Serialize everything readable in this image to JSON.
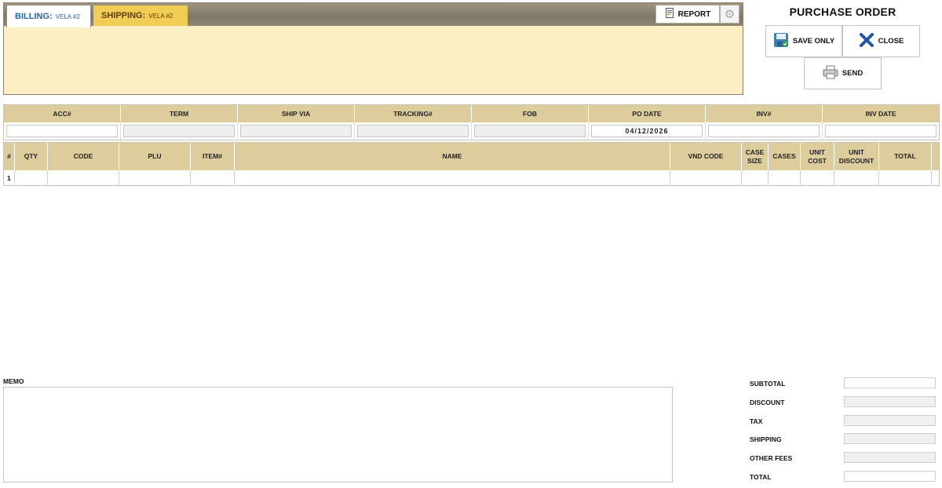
{
  "address_tabs": {
    "billing_label": "BILLING:",
    "billing_value": "VELA #2",
    "shipping_label": "SHIPPING:",
    "shipping_value": "VELA #2",
    "report_label": "REPORT"
  },
  "actions": {
    "title": "PURCHASE ORDER",
    "save_label": "SAVE ONLY",
    "close_label": "CLOSE",
    "send_label": "SEND"
  },
  "header_fields": {
    "labels": [
      "ACC#",
      "TERM",
      "SHIP VIA",
      "TRACKING#",
      "FOB",
      "PO DATE",
      "INV#",
      "INV DATE"
    ],
    "po_date": "04/12/2026"
  },
  "grid": {
    "columns": [
      "#",
      "QTY",
      "CODE",
      "PLU",
      "ITEM#",
      "NAME",
      "VND CODE",
      "CASE SIZE",
      "CASES",
      "UNIT COST",
      "UNIT DISCOUNT",
      "TOTAL"
    ],
    "rows": [
      {
        "num": "1"
      }
    ]
  },
  "memo": {
    "label": "MEMO"
  },
  "totals": {
    "subtotal": "SUBTOTAL",
    "discount": "DISCOUNT",
    "tax": "TAX",
    "shipping": "SHIPPING",
    "other_fees": "OTHER FEES",
    "total": "TOTAL"
  },
  "colors": {
    "address_panel": "#fdefc4",
    "shipping_tab": "#f2cd55",
    "header_tan": "#ddcd9c",
    "billing_text": "#2867a8"
  }
}
